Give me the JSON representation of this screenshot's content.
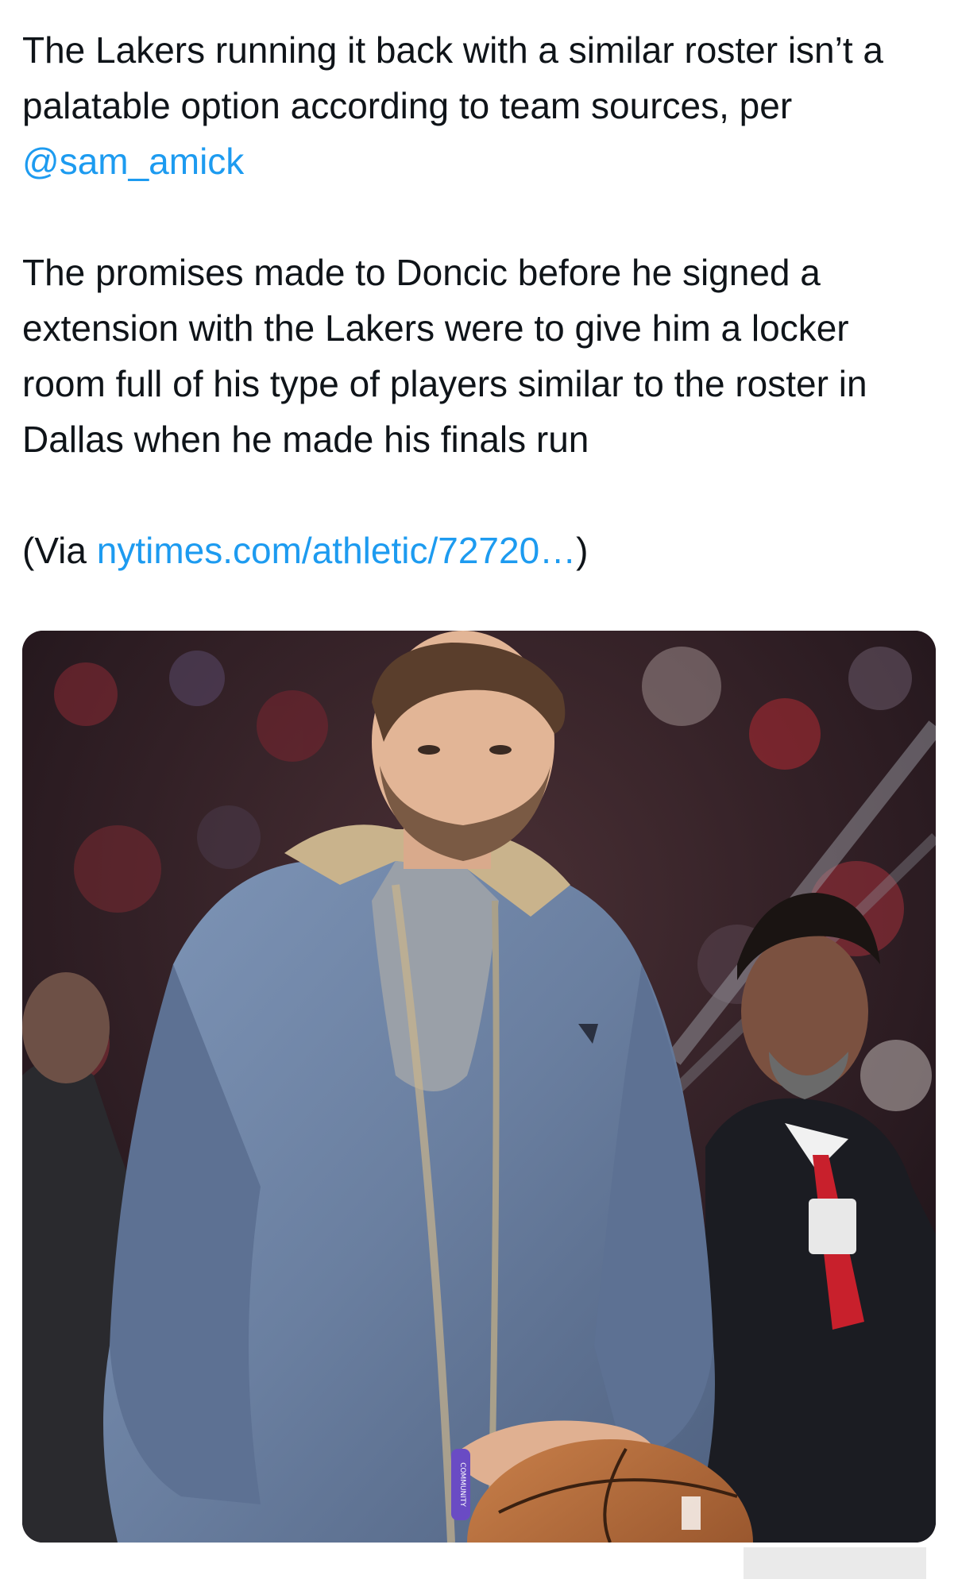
{
  "tweet": {
    "para1_text": "The Lakers running it back with a similar roster isn’t a palatable option according to team sources, per ",
    "mention": "@sam_amick",
    "para2_text": "The promises made to Doncic before he signed a extension with the Lakers were to give him a locker room full of his type of players similar to the roster in Dallas when he made his finals run",
    "via_prefix": "(Via ",
    "link_text": "nytimes.com/athletic/72720…",
    "via_suffix": ")"
  },
  "media": {
    "alt": "Photo of a player in a blue jacket holding a basketball courtside",
    "wristband_text": "COMMUNITY"
  },
  "colors": {
    "link": "#1d9bf0",
    "text": "#0f1419",
    "jacket": "#6f86a8"
  }
}
